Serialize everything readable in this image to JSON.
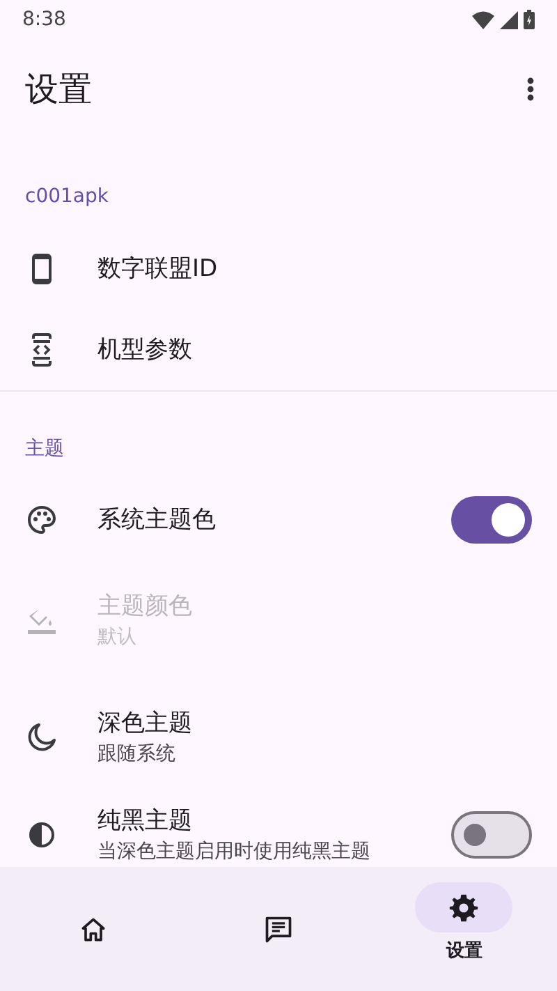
{
  "status_bar": {
    "time": "8:38"
  },
  "app_bar": {
    "title": "设置"
  },
  "sections": [
    {
      "title": "c001apk",
      "items": [
        {
          "kind": "link",
          "title": "数字联盟ID",
          "disabled": false
        },
        {
          "kind": "link",
          "title": "机型参数",
          "disabled": false
        }
      ]
    },
    {
      "title": "主题",
      "items": [
        {
          "kind": "switch",
          "title": "系统主题色",
          "disabled": false,
          "on": true
        },
        {
          "kind": "link",
          "title": "主题颜色",
          "subtitle": "默认",
          "disabled": true
        },
        {
          "kind": "link",
          "title": "深色主题",
          "subtitle": "跟随系统",
          "disabled": false
        },
        {
          "kind": "switch",
          "title": "纯黑主题",
          "subtitle": "当深色主题启用时使用纯黑主题",
          "disabled": false,
          "on": false
        }
      ]
    }
  ],
  "bottom_nav": [
    {
      "selected": false
    },
    {
      "selected": false
    },
    {
      "label": "设置",
      "selected": true
    }
  ]
}
